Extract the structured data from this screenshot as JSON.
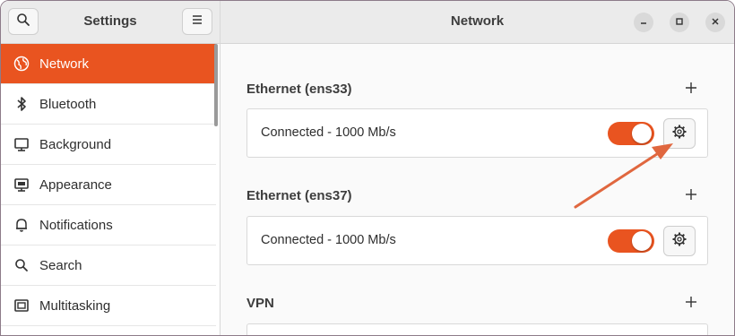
{
  "sidebar": {
    "title": "Settings",
    "items": [
      {
        "label": "Network",
        "icon": "globe-icon",
        "active": true
      },
      {
        "label": "Bluetooth",
        "icon": "bluetooth-icon"
      },
      {
        "label": "Background",
        "icon": "monitor-icon"
      },
      {
        "label": "Appearance",
        "icon": "appearance-icon"
      },
      {
        "label": "Notifications",
        "icon": "bell-icon"
      },
      {
        "label": "Search",
        "icon": "search-icon"
      },
      {
        "label": "Multitasking",
        "icon": "multitasking-icon"
      }
    ]
  },
  "main": {
    "title": "Network",
    "sections": [
      {
        "title": "Ethernet (ens33)",
        "status": "Connected - 1000 Mb/s",
        "enabled": true
      },
      {
        "title": "Ethernet (ens37)",
        "status": "Connected - 1000 Mb/s",
        "enabled": true
      },
      {
        "title": "VPN"
      }
    ]
  },
  "colors": {
    "accent": "#e95420",
    "annotation_arrow": "#e0673f"
  }
}
